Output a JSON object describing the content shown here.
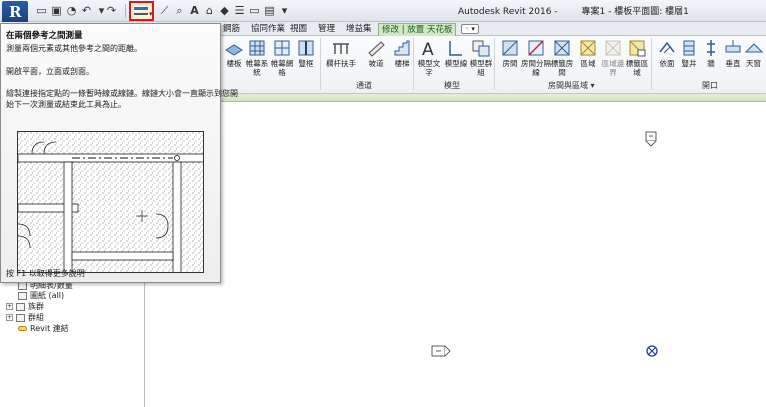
{
  "window": {
    "title": "Autodesk Revit 2016 -",
    "document": "專案1 - 樓板平面圖: 樓層1"
  },
  "tabs": [
    {
      "label": "鋼筋",
      "active": false
    },
    {
      "label": "協同作業",
      "active": false
    },
    {
      "label": "視圖",
      "active": false
    },
    {
      "label": "管理",
      "active": false
    },
    {
      "label": "增益集",
      "active": false
    },
    {
      "label": "修改 | 放置 天花板",
      "active": true
    }
  ],
  "ribbon": {
    "buttons": [
      {
        "label": "樓板",
        "icon": "floor-icon"
      },
      {
        "label": "帷幕系統",
        "icon": "curtain-system-icon"
      },
      {
        "label": "帷幕網格",
        "icon": "curtain-grid-icon"
      },
      {
        "label": "豎框",
        "icon": "mullion-icon"
      },
      {
        "label": "欄杆扶手",
        "icon": "railing-icon"
      },
      {
        "label": "坡道",
        "icon": "ramp-icon"
      },
      {
        "label": "樓梯",
        "icon": "stair-icon"
      },
      {
        "label": "模型文字",
        "icon": "model-text-icon"
      },
      {
        "label": "模型線",
        "icon": "model-line-icon"
      },
      {
        "label": "模型群組",
        "icon": "model-group-icon"
      },
      {
        "label": "房間",
        "icon": "room-icon"
      },
      {
        "label": "房間分隔線",
        "icon": "room-separator-icon"
      },
      {
        "label": "標籤房間",
        "icon": "tag-room-icon"
      },
      {
        "label": "區域",
        "icon": "area-icon"
      },
      {
        "label": "區域邊界",
        "icon": "area-boundary-icon"
      },
      {
        "label": "標籤區域",
        "icon": "tag-area-icon"
      },
      {
        "label": "依面",
        "icon": "by-face-icon"
      },
      {
        "label": "豎井",
        "icon": "shaft-icon"
      },
      {
        "label": "牆",
        "icon": "wall-opening-icon"
      },
      {
        "label": "垂直",
        "icon": "vertical-opening-icon"
      },
      {
        "label": "天窗",
        "icon": "dormer-icon"
      }
    ],
    "panels": [
      {
        "label": "通道"
      },
      {
        "label": "模型"
      },
      {
        "label": "房間與區域 ▾"
      },
      {
        "label": "開口"
      }
    ]
  },
  "tooltip": {
    "title": "在兩個參考之間測量",
    "lines": [
      "測量兩個元素或其他參考之間的距離。",
      "開啟平面，立面或剖面。",
      "繪製連接指定點的一條暫時線或線鏈。線鏈大小會一直顯示到您開",
      "始下一次測量或結束此工具為止。"
    ],
    "footer": "按 F1 以取得更多說明"
  },
  "browser": {
    "items": [
      {
        "label": "明細表/數量",
        "expander": ""
      },
      {
        "label": "圖紙 (all)",
        "expander": ""
      },
      {
        "label": "族群",
        "expander": "+"
      },
      {
        "label": "群組",
        "expander": "+"
      },
      {
        "label": "Revit 連結",
        "expander": ""
      }
    ]
  },
  "colors": {
    "highlight": "#e2141c",
    "active_tab": "#cfe8c5",
    "marker": "#1a3ea8"
  }
}
